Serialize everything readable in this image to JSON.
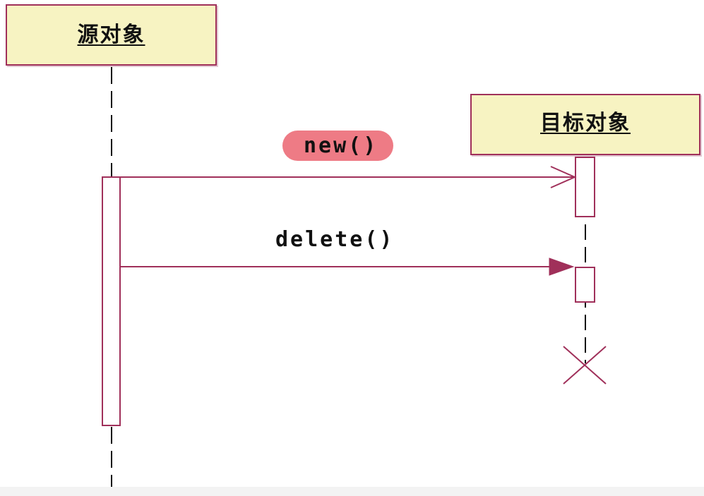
{
  "objects": {
    "source": {
      "label": "源对象"
    },
    "target": {
      "label": "目标对象"
    }
  },
  "messages": [
    {
      "label": "new()",
      "kind": "create",
      "arrowhead": "open-arrow-icon",
      "highlighted": true
    },
    {
      "label": "delete()",
      "kind": "destroy",
      "arrowhead": "filled-arrow-icon",
      "highlighted": false
    }
  ],
  "target_terminator": "destroy-x-icon",
  "colors": {
    "line": "#a0305a",
    "box_fill": "#f7f3c2",
    "highlight": "#ee7b85",
    "activation_fill": "#ffffff"
  }
}
